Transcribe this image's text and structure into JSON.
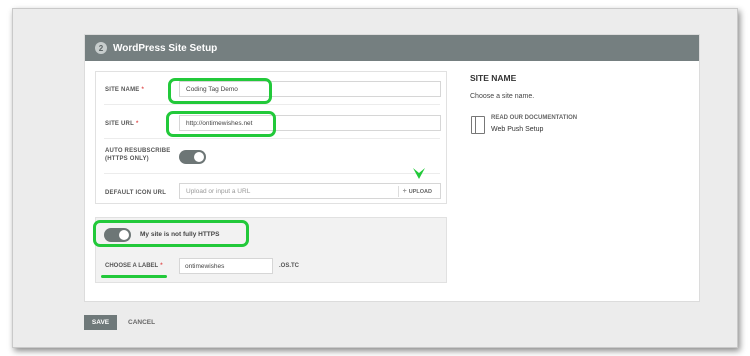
{
  "step": {
    "number": "2",
    "title": "WordPress Site Setup"
  },
  "form": {
    "site_name": {
      "label": "SITE NAME",
      "required": "*",
      "value": "Coding Tag Demo"
    },
    "site_url": {
      "label": "SITE URL",
      "required": "*",
      "value": "http://ontimewishes.net"
    },
    "auto_resubscribe": {
      "label_line1": "AUTO RESUBSCRIBE",
      "label_line2": "(HTTPS ONLY)",
      "enabled": true
    },
    "default_icon": {
      "label": "DEFAULT ICON URL",
      "placeholder": "Upload or input a URL",
      "upload_label": "UPLOAD"
    }
  },
  "https": {
    "toggle_label": "My site is not fully HTTPS",
    "enabled": true,
    "choose_label": {
      "label": "CHOOSE A LABEL",
      "required": "*",
      "value": "ontimewishes",
      "suffix": ".OS.TC"
    }
  },
  "side": {
    "title": "SITE NAME",
    "description": "Choose a site name.",
    "doc_heading": "READ OUR DOCUMENTATION",
    "doc_link": "Web Push Setup"
  },
  "footer": {
    "save_label": "SAVE",
    "cancel_label": "CANCEL"
  },
  "colors": {
    "highlight": "#22c93a",
    "header": "#757f80",
    "toggle_on": "#6d7676"
  },
  "icons": {
    "doc": "document-icon",
    "upload": "plus-icon",
    "step": "step-number-badge"
  }
}
